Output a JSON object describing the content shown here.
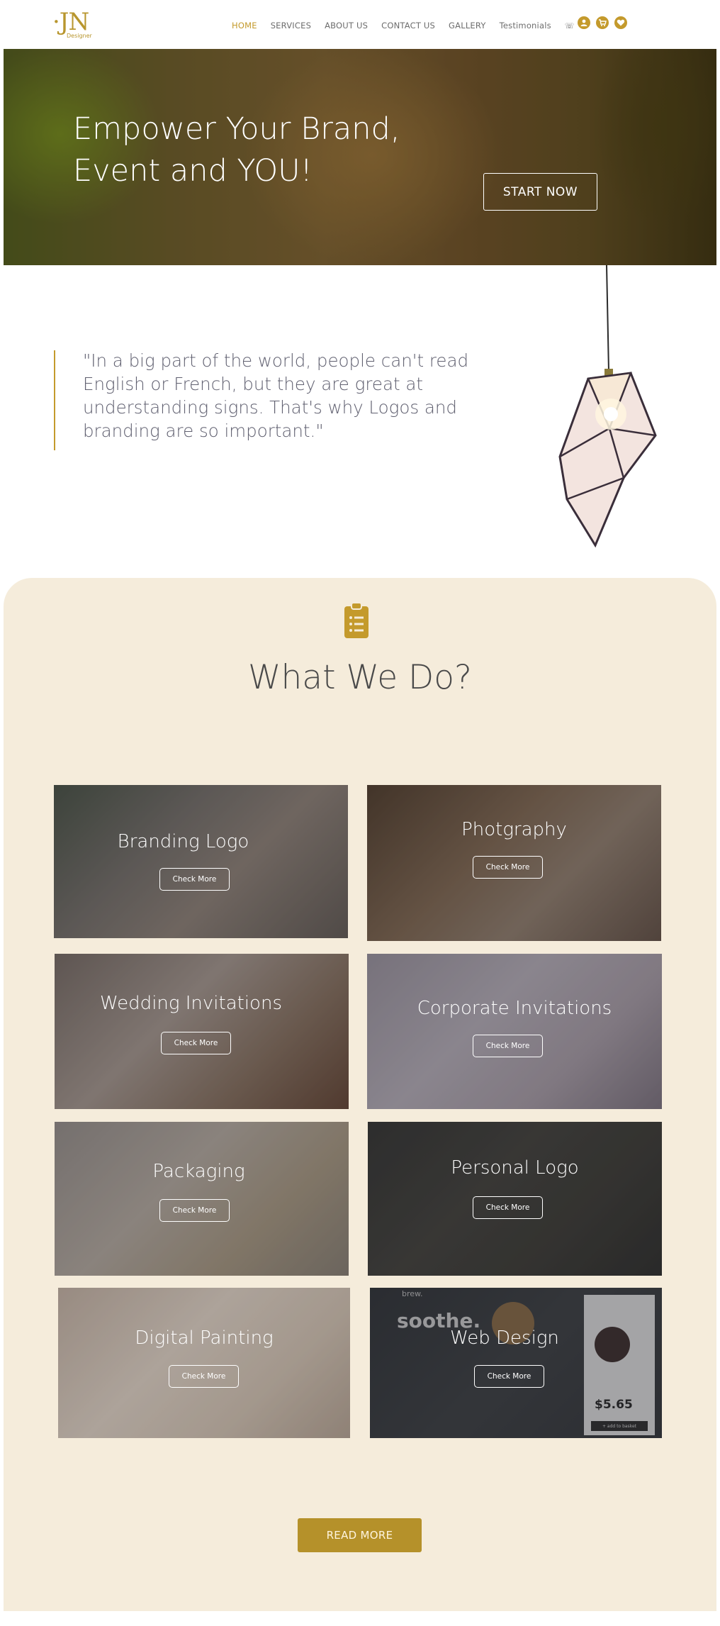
{
  "header": {
    "logo_mark": "·JN",
    "logo_sub": "Designer",
    "nav": [
      {
        "label": "HOME",
        "active": true
      },
      {
        "label": "SERVICES"
      },
      {
        "label": "ABOUT US"
      },
      {
        "label": "CONTACT US"
      },
      {
        "label": "GALLERY"
      },
      {
        "label": "Testimonials"
      }
    ],
    "phone_glyph": "☏",
    "icons": [
      "user-icon",
      "cart-icon",
      "heart-icon"
    ]
  },
  "hero": {
    "title_line1": "Empower Your Brand,",
    "title_line2": "Event and YOU!",
    "cta": "START NOW"
  },
  "quote": {
    "text": "\"In a big part of the world, people can't read English or French, but they are great at understanding signs. That's why Logos and branding are so important.\""
  },
  "services": {
    "icon": "clipboard-list-icon",
    "title": "What We Do?",
    "cards": [
      {
        "title": "Branding Logo",
        "button": "Check More"
      },
      {
        "title": "Photgraphy",
        "button": "Check More"
      },
      {
        "title": "Wedding Invitations",
        "button": "Check More"
      },
      {
        "title": "Corporate Invitations",
        "button": "Check More"
      },
      {
        "title": "Packaging",
        "button": "Check More"
      },
      {
        "title": "Personal Logo",
        "button": "Check More"
      },
      {
        "title": "Digital Painting",
        "button": "Check More"
      },
      {
        "title": "Web Design",
        "button": "Check More"
      }
    ],
    "read_more": "READ MORE"
  },
  "web_design_mock": {
    "brand": "brew.",
    "headline": "soothe.",
    "price": "$5.65",
    "add_button": "+ add to basket"
  },
  "colors": {
    "accent": "#c49a2c",
    "section_bg": "#f5ecdb",
    "read_more_bg": "#b5912a"
  }
}
